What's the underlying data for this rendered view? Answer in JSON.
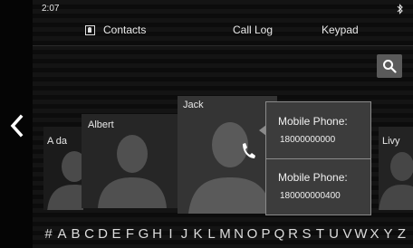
{
  "status_bar": {
    "time": "2:07",
    "bluetooth_icon": "bluetooth-icon"
  },
  "tabs": [
    {
      "label": "Contacts",
      "icon": "contacts-icon",
      "active": true
    },
    {
      "label": "Call Log",
      "active": false
    },
    {
      "label": "Keypad",
      "active": false
    }
  ],
  "search": {
    "icon": "search-icon"
  },
  "navigation": {
    "back_icon": "chevron-left-icon"
  },
  "contacts": [
    {
      "name": "A da"
    },
    {
      "name": "Albert"
    },
    {
      "name": "Jack",
      "selected": true
    },
    {
      "name": "Livy"
    }
  ],
  "phone_popup": {
    "entries": [
      {
        "label": "Mobile Phone:",
        "number": "18000000000"
      },
      {
        "label": "Mobile Phone:",
        "number": "180000000400"
      }
    ],
    "call_icon": "phone-icon"
  },
  "alphabet_index": [
    "#",
    "A",
    "B",
    "C",
    "D",
    "E",
    "F",
    "G",
    "H",
    "I",
    "J",
    "K",
    "L",
    "M",
    "N",
    "O",
    "P",
    "Q",
    "R",
    "S",
    "T",
    "U",
    "V",
    "W",
    "X",
    "Y",
    "Z"
  ],
  "colors": {
    "background": "#0a0a0a",
    "popup_background": "#3c3c3c",
    "popup_border": "#8a8a8a",
    "selected_card": "#343434",
    "search_button": "#5a5a5a"
  }
}
